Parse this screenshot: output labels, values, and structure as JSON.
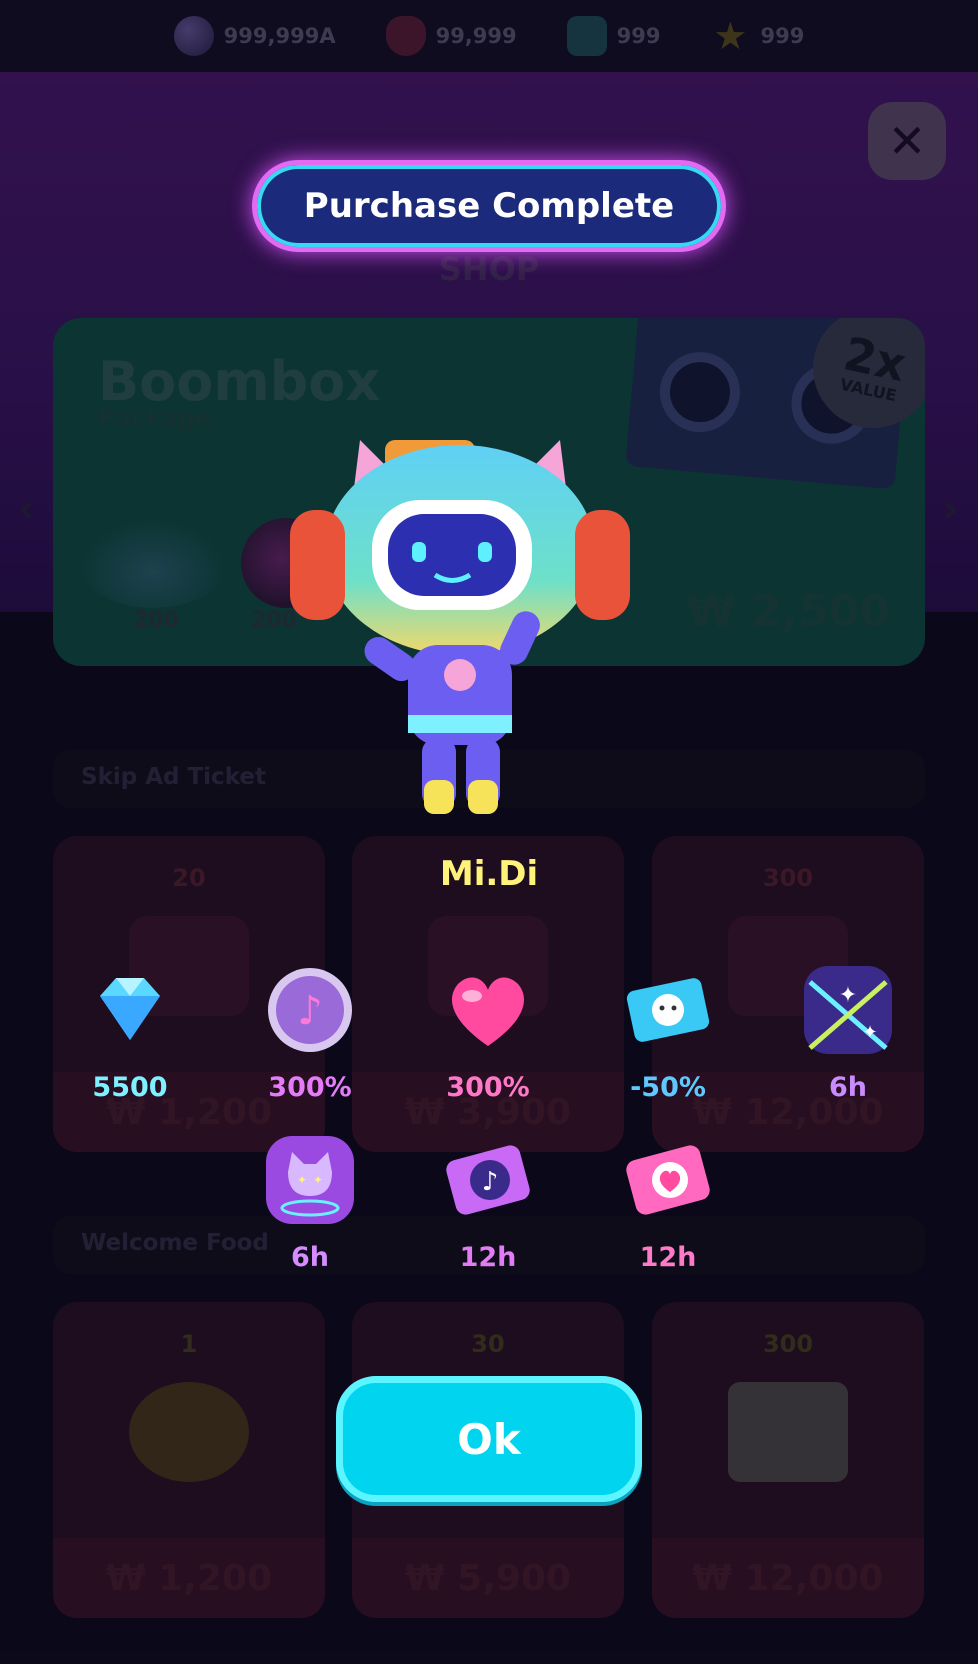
{
  "resources": [
    {
      "icon": "music-orb-icon",
      "value": "999,999A"
    },
    {
      "icon": "heart-icon",
      "value": "99,999"
    },
    {
      "icon": "gem-icon",
      "value": "999"
    },
    {
      "icon": "star-icon",
      "value": "999"
    }
  ],
  "shop": {
    "label": "SHOP",
    "featured": {
      "title": "Boombox",
      "subtitle": "Package",
      "price": "₩ 2,500",
      "badge_big": "2x",
      "badge_small": "VALUE",
      "items": [
        {
          "label": "200"
        },
        {
          "label": "200"
        }
      ]
    },
    "sections": [
      {
        "title": "Skip Ad Ticket",
        "cards": [
          {
            "count": "20",
            "price": "₩ 1,200"
          },
          {
            "count": "",
            "price": "₩ 3,900"
          },
          {
            "count": "300",
            "price": "₩ 12,000"
          }
        ]
      },
      {
        "title": "Welcome Food",
        "cards": [
          {
            "count": "1",
            "price": "₩ 1,200"
          },
          {
            "count": "30",
            "price": "₩ 5,900"
          },
          {
            "count": "300",
            "price": "₩ 12,000"
          }
        ]
      }
    ]
  },
  "modal": {
    "title": "Purchase Complete",
    "character_name": "Mi.Di",
    "rewards": [
      {
        "icon": "diamond-icon",
        "label": "5500",
        "color": "#7ff0ff"
      },
      {
        "icon": "music-orb-icon",
        "label": "300%",
        "color": "#e47cf7"
      },
      {
        "icon": "heart-icon",
        "label": "300%",
        "color": "#ff78c8"
      },
      {
        "icon": "cat-ticket-icon",
        "label": "-50%",
        "color": "#5ec8ff"
      },
      {
        "icon": "neon-light-icon",
        "label": "6h",
        "color": "#c98cff"
      },
      {
        "icon": "cat-booster-icon",
        "label": "6h",
        "color": "#d58cff"
      },
      {
        "icon": "music-ticket-icon",
        "label": "12h",
        "color": "#e27cf5"
      },
      {
        "icon": "heart-ticket-icon",
        "label": "12h",
        "color": "#ff7bc8"
      }
    ],
    "ok_label": "Ok"
  },
  "colors": {
    "accent": "#00d4ee",
    "title_border": "#e36af2",
    "name": "#fff27a"
  }
}
